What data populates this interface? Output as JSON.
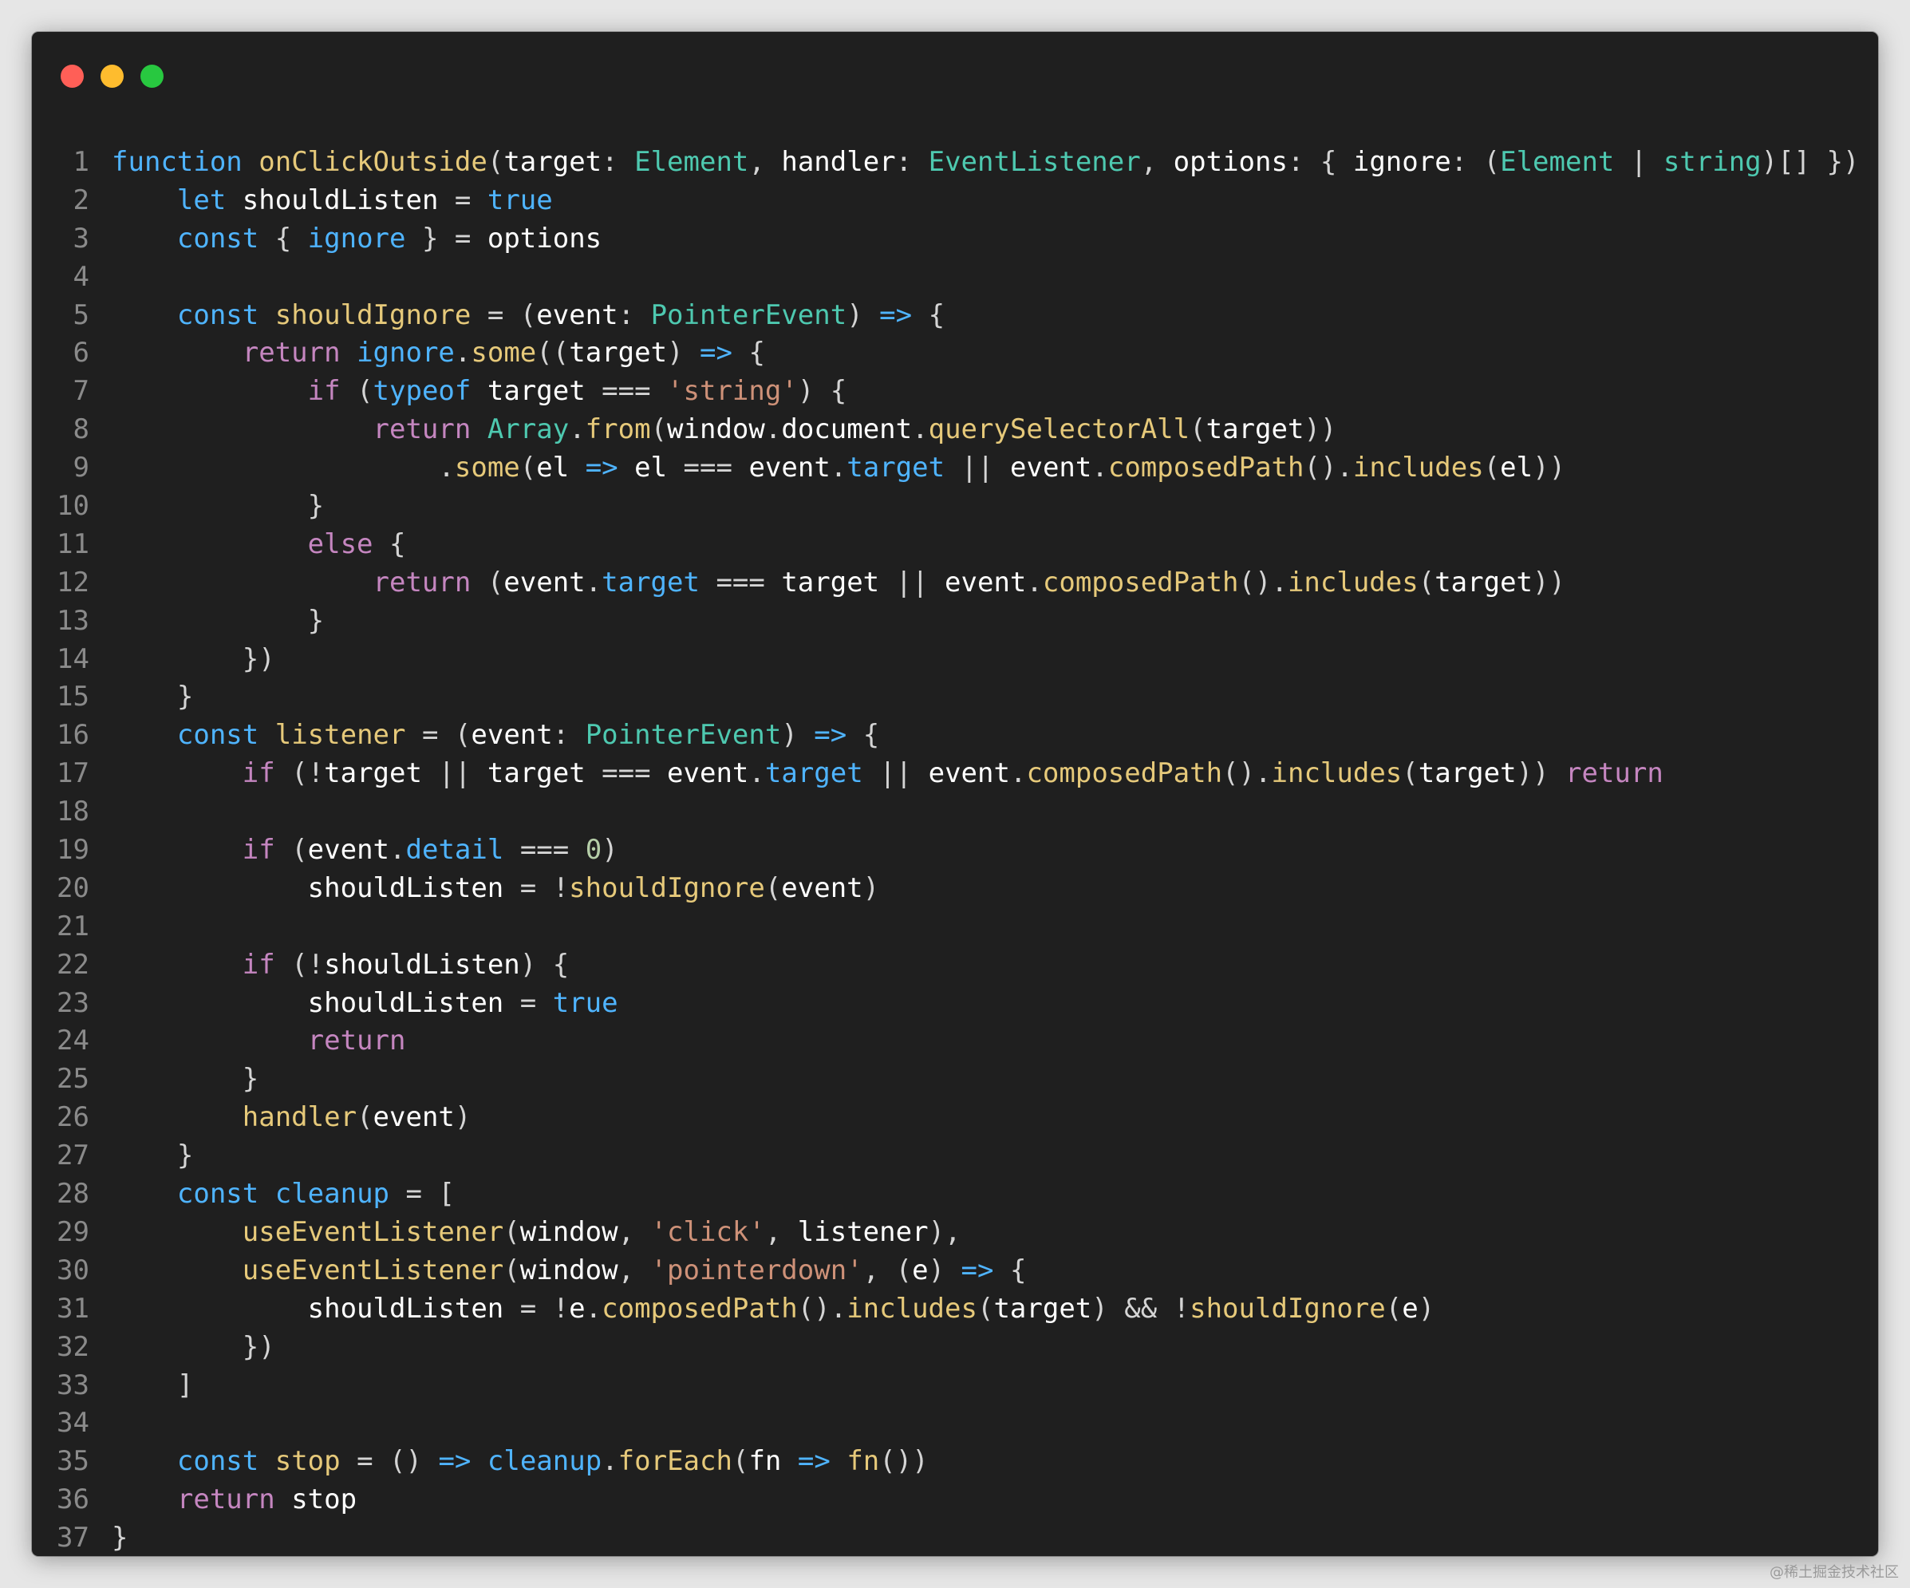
{
  "window": {
    "controls": {
      "close": "#ff5f57",
      "minimize": "#febc2e",
      "maximize": "#28c840"
    }
  },
  "theme": {
    "background": "#1f1f1f",
    "line_number": "#8a8a8a",
    "keyword": "#4fb4ff",
    "control": "#c586c0",
    "function": "#e6c97a",
    "type": "#4ec9b0",
    "string": "#ce9178",
    "number": "#b5cea8",
    "variable": "#ffffff",
    "punctuation": "#d4d4d4"
  },
  "code": {
    "lines": [
      {
        "n": "1",
        "tokens": [
          [
            "kw",
            "function"
          ],
          [
            "p",
            " "
          ],
          [
            "fn",
            "onClickOutside"
          ],
          [
            "p",
            "("
          ],
          [
            "v",
            "target"
          ],
          [
            "p",
            ": "
          ],
          [
            "type",
            "Element"
          ],
          [
            "p",
            ", "
          ],
          [
            "v",
            "handler"
          ],
          [
            "p",
            ": "
          ],
          [
            "type",
            "EventListener"
          ],
          [
            "p",
            ", "
          ],
          [
            "v",
            "options"
          ],
          [
            "p",
            ": { "
          ],
          [
            "v",
            "ignore"
          ],
          [
            "p",
            ": ("
          ],
          [
            "type",
            "Element"
          ],
          [
            "p",
            " | "
          ],
          [
            "type",
            "string"
          ],
          [
            "p",
            ")[] }) {"
          ]
        ]
      },
      {
        "n": "2",
        "tokens": [
          [
            "p",
            "    "
          ],
          [
            "kw",
            "let"
          ],
          [
            "p",
            " "
          ],
          [
            "v",
            "shouldListen"
          ],
          [
            "p",
            " = "
          ],
          [
            "kw",
            "true"
          ]
        ]
      },
      {
        "n": "3",
        "tokens": [
          [
            "p",
            "    "
          ],
          [
            "kw",
            "const"
          ],
          [
            "p",
            " { "
          ],
          [
            "prop",
            "ignore"
          ],
          [
            "p",
            " } = "
          ],
          [
            "v",
            "options"
          ]
        ]
      },
      {
        "n": "4",
        "tokens": []
      },
      {
        "n": "5",
        "tokens": [
          [
            "p",
            "    "
          ],
          [
            "kw",
            "const"
          ],
          [
            "p",
            " "
          ],
          [
            "fn",
            "shouldIgnore"
          ],
          [
            "p",
            " = ("
          ],
          [
            "v",
            "event"
          ],
          [
            "p",
            ": "
          ],
          [
            "type",
            "PointerEvent"
          ],
          [
            "p",
            ") "
          ],
          [
            "kw",
            "=>"
          ],
          [
            "p",
            " {"
          ]
        ]
      },
      {
        "n": "6",
        "tokens": [
          [
            "p",
            "        "
          ],
          [
            "ctrl",
            "return"
          ],
          [
            "p",
            " "
          ],
          [
            "prop",
            "ignore"
          ],
          [
            "p",
            "."
          ],
          [
            "fn",
            "some"
          ],
          [
            "p",
            "(("
          ],
          [
            "v",
            "target"
          ],
          [
            "p",
            ") "
          ],
          [
            "kw",
            "=>"
          ],
          [
            "p",
            " {"
          ]
        ]
      },
      {
        "n": "7",
        "tokens": [
          [
            "p",
            "            "
          ],
          [
            "ctrl",
            "if"
          ],
          [
            "p",
            " ("
          ],
          [
            "kw",
            "typeof"
          ],
          [
            "p",
            " "
          ],
          [
            "v",
            "target"
          ],
          [
            "p",
            " === "
          ],
          [
            "str",
            "'string'"
          ],
          [
            "p",
            ") {"
          ]
        ]
      },
      {
        "n": "8",
        "tokens": [
          [
            "p",
            "                "
          ],
          [
            "ctrl",
            "return"
          ],
          [
            "p",
            " "
          ],
          [
            "type",
            "Array"
          ],
          [
            "p",
            "."
          ],
          [
            "fn",
            "from"
          ],
          [
            "p",
            "("
          ],
          [
            "v",
            "window"
          ],
          [
            "p",
            "."
          ],
          [
            "v",
            "document"
          ],
          [
            "p",
            "."
          ],
          [
            "fn",
            "querySelectorAll"
          ],
          [
            "p",
            "("
          ],
          [
            "v",
            "target"
          ],
          [
            "p",
            "))"
          ]
        ]
      },
      {
        "n": "9",
        "tokens": [
          [
            "p",
            "                    ."
          ],
          [
            "fn",
            "some"
          ],
          [
            "p",
            "("
          ],
          [
            "v",
            "el"
          ],
          [
            "p",
            " "
          ],
          [
            "kw",
            "=>"
          ],
          [
            "p",
            " "
          ],
          [
            "v",
            "el"
          ],
          [
            "p",
            " === "
          ],
          [
            "v",
            "event"
          ],
          [
            "p",
            "."
          ],
          [
            "prop",
            "target"
          ],
          [
            "p",
            " || "
          ],
          [
            "v",
            "event"
          ],
          [
            "p",
            "."
          ],
          [
            "fn",
            "composedPath"
          ],
          [
            "p",
            "()."
          ],
          [
            "fn",
            "includes"
          ],
          [
            "p",
            "("
          ],
          [
            "v",
            "el"
          ],
          [
            "p",
            "))"
          ]
        ]
      },
      {
        "n": "10",
        "tokens": [
          [
            "p",
            "            }"
          ]
        ]
      },
      {
        "n": "11",
        "tokens": [
          [
            "p",
            "            "
          ],
          [
            "ctrl",
            "else"
          ],
          [
            "p",
            " {"
          ]
        ]
      },
      {
        "n": "12",
        "tokens": [
          [
            "p",
            "                "
          ],
          [
            "ctrl",
            "return"
          ],
          [
            "p",
            " ("
          ],
          [
            "v",
            "event"
          ],
          [
            "p",
            "."
          ],
          [
            "prop",
            "target"
          ],
          [
            "p",
            " === "
          ],
          [
            "v",
            "target"
          ],
          [
            "p",
            " || "
          ],
          [
            "v",
            "event"
          ],
          [
            "p",
            "."
          ],
          [
            "fn",
            "composedPath"
          ],
          [
            "p",
            "()."
          ],
          [
            "fn",
            "includes"
          ],
          [
            "p",
            "("
          ],
          [
            "v",
            "target"
          ],
          [
            "p",
            "))"
          ]
        ]
      },
      {
        "n": "13",
        "tokens": [
          [
            "p",
            "            }"
          ]
        ]
      },
      {
        "n": "14",
        "tokens": [
          [
            "p",
            "        })"
          ]
        ]
      },
      {
        "n": "15",
        "tokens": [
          [
            "p",
            "    }"
          ]
        ]
      },
      {
        "n": "16",
        "tokens": [
          [
            "p",
            "    "
          ],
          [
            "kw",
            "const"
          ],
          [
            "p",
            " "
          ],
          [
            "fn",
            "listener"
          ],
          [
            "p",
            " = ("
          ],
          [
            "v",
            "event"
          ],
          [
            "p",
            ": "
          ],
          [
            "type",
            "PointerEvent"
          ],
          [
            "p",
            ") "
          ],
          [
            "kw",
            "=>"
          ],
          [
            "p",
            " {"
          ]
        ]
      },
      {
        "n": "17",
        "tokens": [
          [
            "p",
            "        "
          ],
          [
            "ctrl",
            "if"
          ],
          [
            "p",
            " (!"
          ],
          [
            "v",
            "target"
          ],
          [
            "p",
            " || "
          ],
          [
            "v",
            "target"
          ],
          [
            "p",
            " === "
          ],
          [
            "v",
            "event"
          ],
          [
            "p",
            "."
          ],
          [
            "prop",
            "target"
          ],
          [
            "p",
            " || "
          ],
          [
            "v",
            "event"
          ],
          [
            "p",
            "."
          ],
          [
            "fn",
            "composedPath"
          ],
          [
            "p",
            "()."
          ],
          [
            "fn",
            "includes"
          ],
          [
            "p",
            "("
          ],
          [
            "v",
            "target"
          ],
          [
            "p",
            ")) "
          ],
          [
            "ctrl",
            "return"
          ]
        ]
      },
      {
        "n": "18",
        "tokens": []
      },
      {
        "n": "19",
        "tokens": [
          [
            "p",
            "        "
          ],
          [
            "ctrl",
            "if"
          ],
          [
            "p",
            " ("
          ],
          [
            "v",
            "event"
          ],
          [
            "p",
            "."
          ],
          [
            "prop",
            "detail"
          ],
          [
            "p",
            " === "
          ],
          [
            "num",
            "0"
          ],
          [
            "p",
            ")"
          ]
        ]
      },
      {
        "n": "20",
        "tokens": [
          [
            "p",
            "            "
          ],
          [
            "v",
            "shouldListen"
          ],
          [
            "p",
            " = !"
          ],
          [
            "fn",
            "shouldIgnore"
          ],
          [
            "p",
            "("
          ],
          [
            "v",
            "event"
          ],
          [
            "p",
            ")"
          ]
        ]
      },
      {
        "n": "21",
        "tokens": []
      },
      {
        "n": "22",
        "tokens": [
          [
            "p",
            "        "
          ],
          [
            "ctrl",
            "if"
          ],
          [
            "p",
            " (!"
          ],
          [
            "v",
            "shouldListen"
          ],
          [
            "p",
            ") {"
          ]
        ]
      },
      {
        "n": "23",
        "tokens": [
          [
            "p",
            "            "
          ],
          [
            "v",
            "shouldListen"
          ],
          [
            "p",
            " = "
          ],
          [
            "kw",
            "true"
          ]
        ]
      },
      {
        "n": "24",
        "tokens": [
          [
            "p",
            "            "
          ],
          [
            "ctrl",
            "return"
          ]
        ]
      },
      {
        "n": "25",
        "tokens": [
          [
            "p",
            "        }"
          ]
        ]
      },
      {
        "n": "26",
        "tokens": [
          [
            "p",
            "        "
          ],
          [
            "fn",
            "handler"
          ],
          [
            "p",
            "("
          ],
          [
            "v",
            "event"
          ],
          [
            "p",
            ")"
          ]
        ]
      },
      {
        "n": "27",
        "tokens": [
          [
            "p",
            "    }"
          ]
        ]
      },
      {
        "n": "28",
        "tokens": [
          [
            "p",
            "    "
          ],
          [
            "kw",
            "const"
          ],
          [
            "p",
            " "
          ],
          [
            "prop",
            "cleanup"
          ],
          [
            "p",
            " = ["
          ]
        ]
      },
      {
        "n": "29",
        "tokens": [
          [
            "p",
            "        "
          ],
          [
            "fn",
            "useEventListener"
          ],
          [
            "p",
            "("
          ],
          [
            "v",
            "window"
          ],
          [
            "p",
            ", "
          ],
          [
            "str",
            "'click'"
          ],
          [
            "p",
            ", "
          ],
          [
            "v",
            "listener"
          ],
          [
            "p",
            "),"
          ]
        ]
      },
      {
        "n": "30",
        "tokens": [
          [
            "p",
            "        "
          ],
          [
            "fn",
            "useEventListener"
          ],
          [
            "p",
            "("
          ],
          [
            "v",
            "window"
          ],
          [
            "p",
            ", "
          ],
          [
            "str",
            "'pointerdown'"
          ],
          [
            "p",
            ", ("
          ],
          [
            "v",
            "e"
          ],
          [
            "p",
            ") "
          ],
          [
            "kw",
            "=>"
          ],
          [
            "p",
            " {"
          ]
        ]
      },
      {
        "n": "31",
        "tokens": [
          [
            "p",
            "            "
          ],
          [
            "v",
            "shouldListen"
          ],
          [
            "p",
            " = !"
          ],
          [
            "v",
            "e"
          ],
          [
            "p",
            "."
          ],
          [
            "fn",
            "composedPath"
          ],
          [
            "p",
            "()."
          ],
          [
            "fn",
            "includes"
          ],
          [
            "p",
            "("
          ],
          [
            "v",
            "target"
          ],
          [
            "p",
            ") && !"
          ],
          [
            "fn",
            "shouldIgnore"
          ],
          [
            "p",
            "("
          ],
          [
            "v",
            "e"
          ],
          [
            "p",
            ")"
          ]
        ]
      },
      {
        "n": "32",
        "tokens": [
          [
            "p",
            "        })"
          ]
        ]
      },
      {
        "n": "33",
        "tokens": [
          [
            "p",
            "    ]"
          ]
        ]
      },
      {
        "n": "34",
        "tokens": []
      },
      {
        "n": "35",
        "tokens": [
          [
            "p",
            "    "
          ],
          [
            "kw",
            "const"
          ],
          [
            "p",
            " "
          ],
          [
            "fn",
            "stop"
          ],
          [
            "p",
            " = () "
          ],
          [
            "kw",
            "=>"
          ],
          [
            "p",
            " "
          ],
          [
            "prop",
            "cleanup"
          ],
          [
            "p",
            "."
          ],
          [
            "fn",
            "forEach"
          ],
          [
            "p",
            "("
          ],
          [
            "v",
            "fn"
          ],
          [
            "p",
            " "
          ],
          [
            "kw",
            "=>"
          ],
          [
            "p",
            " "
          ],
          [
            "fn",
            "fn"
          ],
          [
            "p",
            "())"
          ]
        ]
      },
      {
        "n": "36",
        "tokens": [
          [
            "p",
            "    "
          ],
          [
            "ctrl",
            "return"
          ],
          [
            "p",
            " "
          ],
          [
            "v",
            "stop"
          ]
        ]
      },
      {
        "n": "37",
        "tokens": [
          [
            "p",
            "}"
          ]
        ]
      }
    ]
  },
  "watermark": "@稀土掘金技术社区"
}
